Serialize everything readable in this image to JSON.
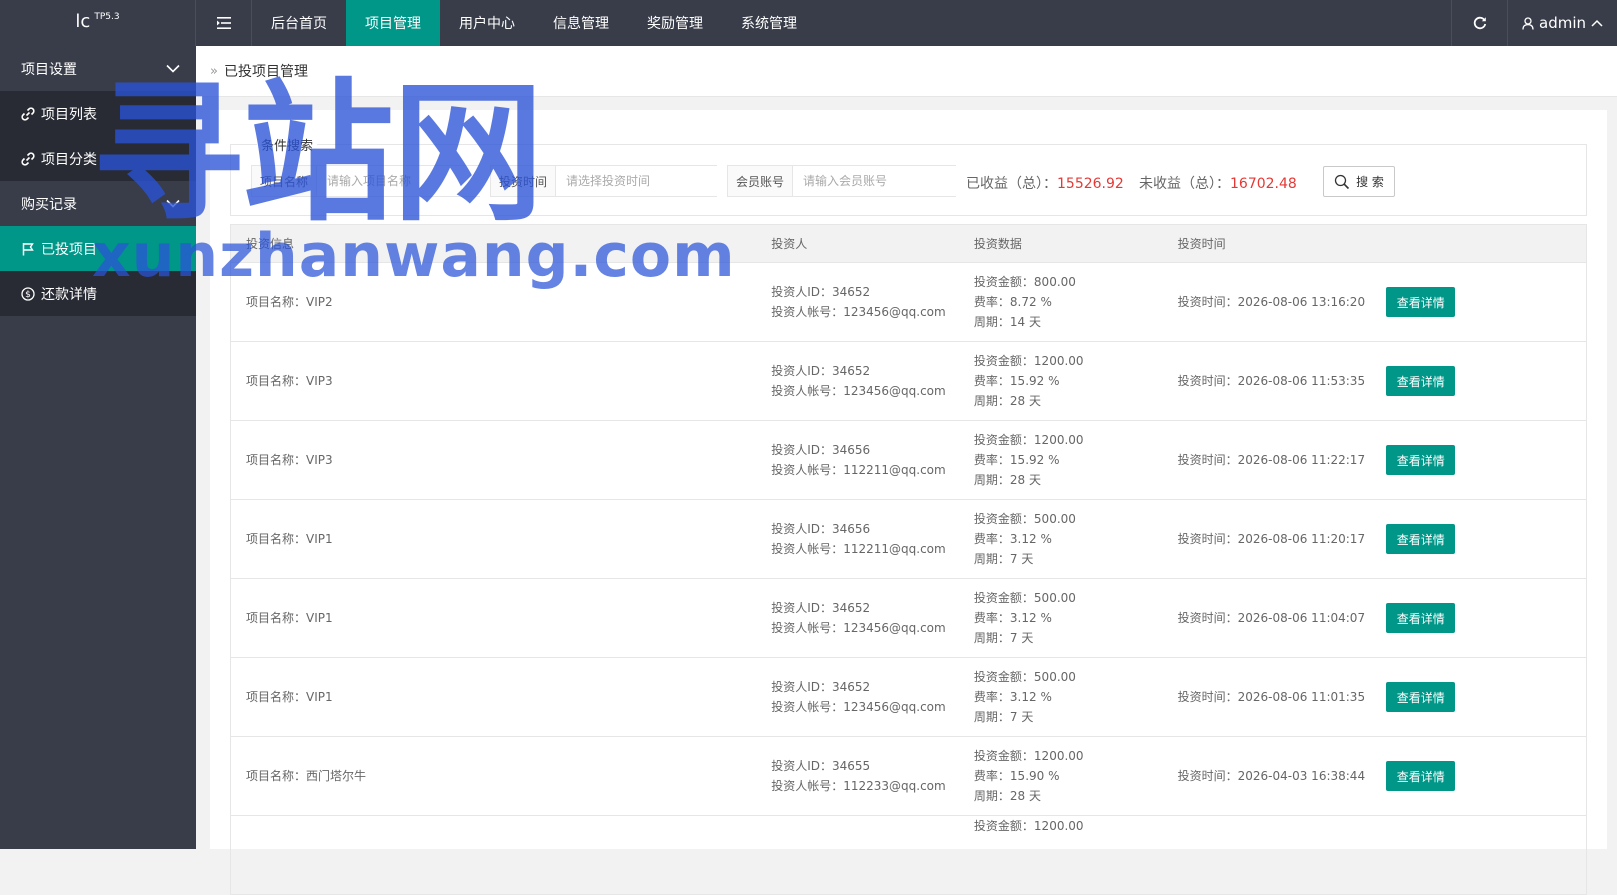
{
  "app": {
    "logo": "lc",
    "version": "TP5.3"
  },
  "header": {
    "nav": [
      "后台首页",
      "项目管理",
      "用户中心",
      "信息管理",
      "奖励管理",
      "系统管理"
    ],
    "user": "admin"
  },
  "sidebar": {
    "group1": "项目设置",
    "items1": [
      "项目列表",
      "项目分类"
    ],
    "group2": "购买记录",
    "items2": [
      "已投项目",
      "还款详情"
    ]
  },
  "breadcrumb": "已投项目管理",
  "filter": {
    "legend": "条件搜索",
    "project_label": "项目名称",
    "project_placeholder": "请输入项目名称",
    "time_label": "投资时间",
    "time_placeholder": "请选择投资时间",
    "member_label": "会员账号",
    "member_placeholder": "请输入会员账号",
    "earned_label": "已收益（总）：",
    "earned_value": "15526.92",
    "unearned_label": "未收益（总）：",
    "unearned_value": "16702.48",
    "search_label": "搜 索"
  },
  "table": {
    "headers": [
      "投资信息",
      "投资人",
      "投资数据",
      "投资时间"
    ],
    "detail_label": "查看详情",
    "rows": [
      {
        "name": "项目名称：VIP2",
        "id": "投资人ID：34652",
        "account": "投资人帐号：123456@qq.com",
        "amount": "投资金额：800.00",
        "rate": "费率：8.72 %",
        "period": "周期：14 天",
        "time": "投资时间：2026-08-06 13:16:20"
      },
      {
        "name": "项目名称：VIP3",
        "id": "投资人ID：34652",
        "account": "投资人帐号：123456@qq.com",
        "amount": "投资金额：1200.00",
        "rate": "费率：15.92 %",
        "period": "周期：28 天",
        "time": "投资时间：2026-08-06 11:53:35"
      },
      {
        "name": "项目名称：VIP3",
        "id": "投资人ID：34656",
        "account": "投资人帐号：112211@qq.com",
        "amount": "投资金额：1200.00",
        "rate": "费率：15.92 %",
        "period": "周期：28 天",
        "time": "投资时间：2026-08-06 11:22:17"
      },
      {
        "name": "项目名称：VIP1",
        "id": "投资人ID：34656",
        "account": "投资人帐号：112211@qq.com",
        "amount": "投资金额：500.00",
        "rate": "费率：3.12 %",
        "period": "周期：7 天",
        "time": "投资时间：2026-08-06 11:20:17"
      },
      {
        "name": "项目名称：VIP1",
        "id": "投资人ID：34652",
        "account": "投资人帐号：123456@qq.com",
        "amount": "投资金额：500.00",
        "rate": "费率：3.12 %",
        "period": "周期：7 天",
        "time": "投资时间：2026-08-06 11:04:07"
      },
      {
        "name": "项目名称：VIP1",
        "id": "投资人ID：34652",
        "account": "投资人帐号：123456@qq.com",
        "amount": "投资金额：500.00",
        "rate": "费率：3.12 %",
        "period": "周期：7 天",
        "time": "投资时间：2026-08-06 11:01:35"
      },
      {
        "name": "项目名称：西门塔尔牛",
        "id": "投资人ID：34655",
        "account": "投资人帐号：112233@qq.com",
        "amount": "投资金额：1200.00",
        "rate": "费率：15.90 %",
        "period": "周期：28 天",
        "time": "投资时间：2026-04-03 16:38:44"
      },
      {
        "name": "",
        "id": "",
        "account": "",
        "amount": "投资金额：1200.00",
        "rate": "",
        "period": "",
        "time": ""
      }
    ]
  },
  "watermark": {
    "big": "寻站网",
    "small": "xunzhanwang.com"
  },
  "colors": {
    "primary": "#009688",
    "header_bg": "#393d49",
    "highlight": "#e53935"
  }
}
